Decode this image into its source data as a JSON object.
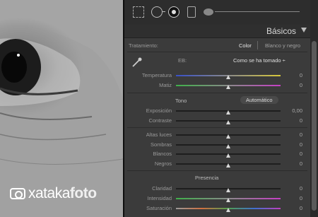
{
  "watermark": {
    "lead": "xataka",
    "accent": "foto"
  },
  "panel": {
    "title": "Básicos",
    "tratamiento": {
      "label": "Tratamiento:",
      "options": [
        "Color",
        "Blanco y negro"
      ]
    },
    "wb": {
      "label": "EB:",
      "value": "Como se ha tomado ÷"
    },
    "sliders_wb": [
      {
        "label": "Temperatura",
        "value": "0",
        "position": 0.5
      },
      {
        "label": "Matiz",
        "value": "0",
        "position": 0.5
      }
    ],
    "tono": {
      "label": "Tono",
      "auto_button": "Automático"
    },
    "sliders_tono": [
      {
        "label": "Exposición",
        "value": "0,00",
        "position": 0.5
      },
      {
        "label": "Contraste",
        "value": "0",
        "position": 0.5
      }
    ],
    "sliders_luces": [
      {
        "label": "Altas luces",
        "value": "0",
        "position": 0.5
      },
      {
        "label": "Sombras",
        "value": "0",
        "position": 0.5
      },
      {
        "label": "Blancos",
        "value": "0",
        "position": 0.5
      },
      {
        "label": "Negros",
        "value": "0",
        "position": 0.5
      }
    ],
    "presencia": {
      "label": "Presencia"
    },
    "sliders_presencia": [
      {
        "label": "Claridad",
        "value": "0",
        "position": 0.5
      },
      {
        "label": "Intensidad",
        "value": "0",
        "position": 0.5
      },
      {
        "label": "Saturación",
        "value": "0",
        "position": 0.5
      }
    ]
  },
  "tools": [
    "crop-overlay-icon",
    "spot-removal-icon",
    "red-eye-icon",
    "graduated-filter-icon",
    "adjustment-brush-icon"
  ]
}
